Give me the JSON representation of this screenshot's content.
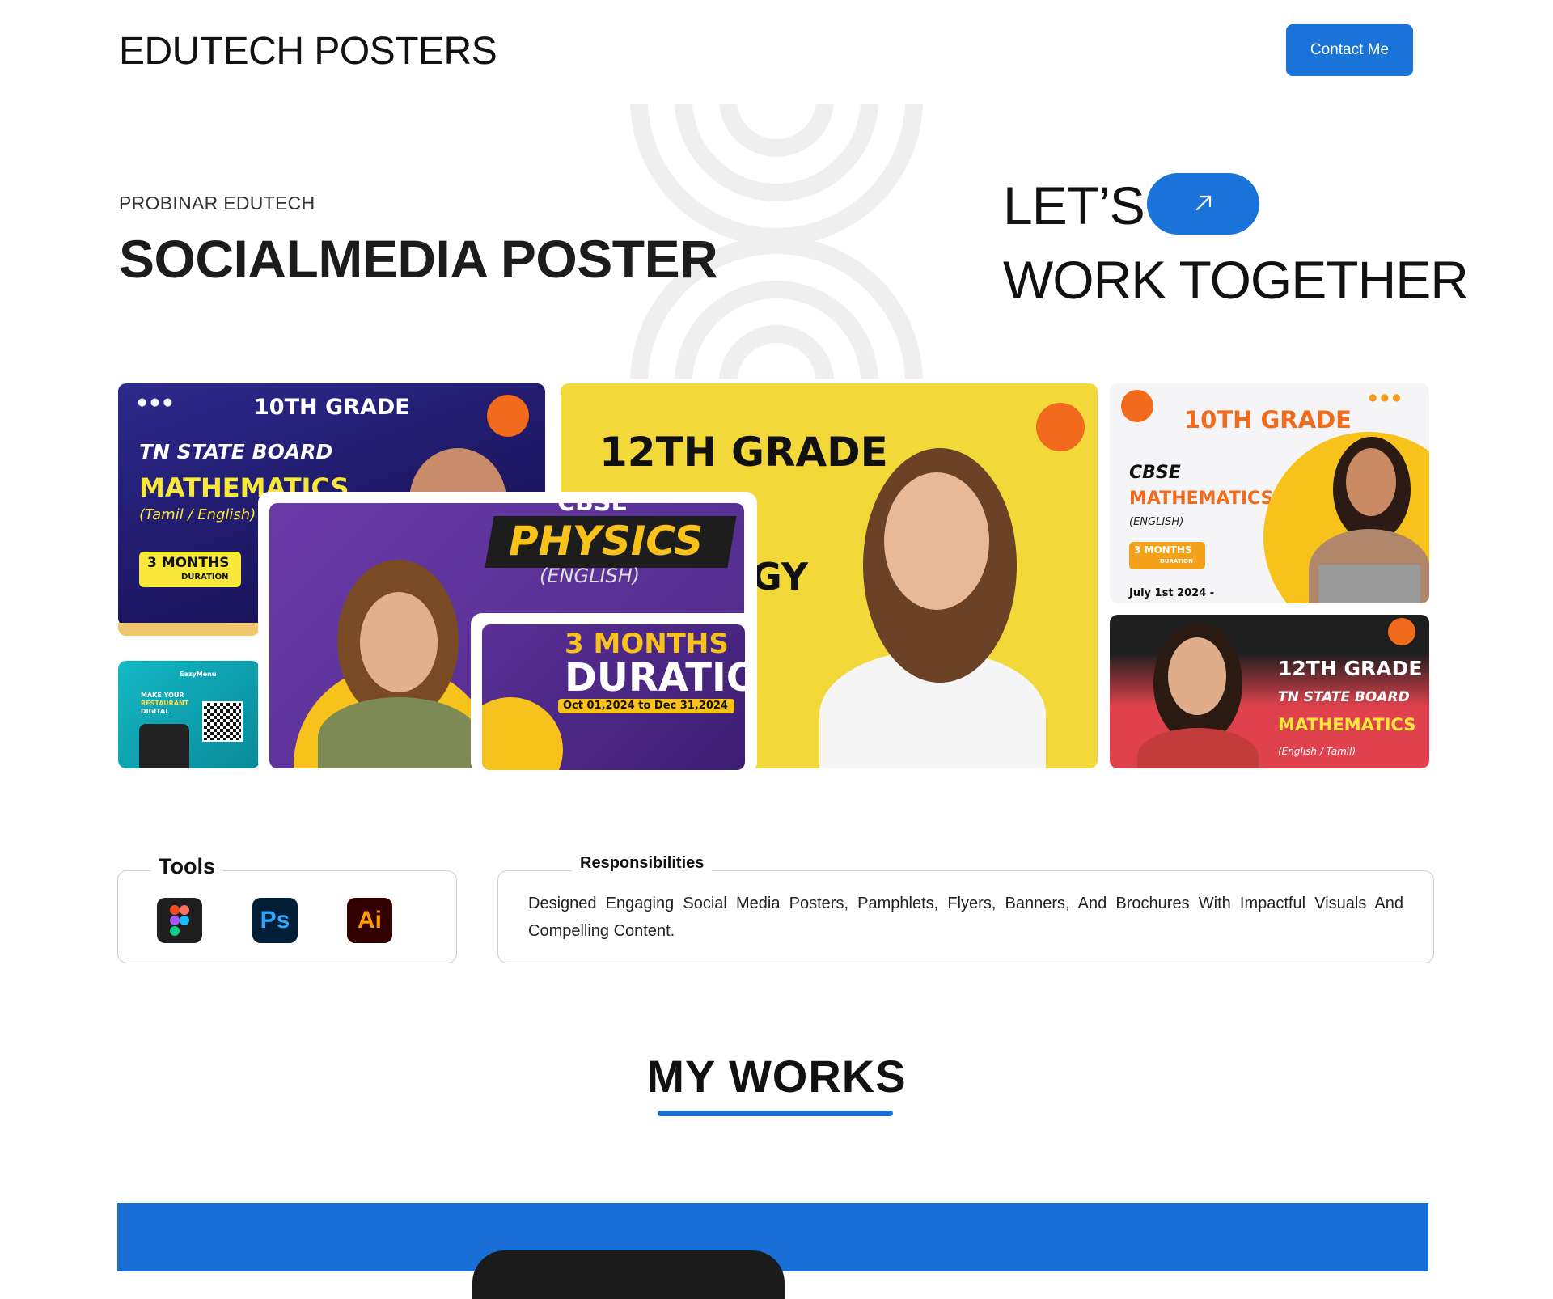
{
  "header": {
    "brand": "EDUTECH POSTERS",
    "contact_label": "Contact Me"
  },
  "hero": {
    "eyebrow": "PROBINAR EDUTECH",
    "title": "SOCIALMEDIA POSTER",
    "cta_line1": "LET’S",
    "cta_line2": "WORK TOGETHER",
    "cta_icon": "arrow-up-right-icon"
  },
  "posters": {
    "p1": {
      "grade": "10TH GRADE",
      "board": "TN STATE BOARD",
      "subject": "MATHEMATICS",
      "lang": "(Tamil / English)",
      "badge1": "3 MONTHS",
      "badge2": "DURATION"
    },
    "p2": {
      "grade": "12TH GRADE",
      "partial": "GY"
    },
    "p3": {
      "grade": "10TH GRADE",
      "board": "CBSE",
      "subject": "MATHEMATICS",
      "lang": "(ENGLISH)",
      "badge1": "3 MONTHS",
      "badge2": "DURATION",
      "date": "July 1st 2024 -"
    },
    "p4": {
      "grade": "12TH GRADE",
      "board": "TN STATE BOARD",
      "subject": "MATHEMATICS",
      "lang": "(English / Tamil)"
    },
    "p5": {
      "top": "CBSE",
      "subject": "PHYSICS",
      "lang": "(ENGLISH)"
    },
    "p6": {
      "line1": "3 MONTHS",
      "line2": "DURATION",
      "dates": "Oct 01,2024 to Dec 31,2024"
    },
    "p7": {
      "brand": "EazyMenu",
      "line1": "MAKE YOUR",
      "line2": "RESTAURANT",
      "line3": "DIGITAL"
    }
  },
  "tools": {
    "label": "Tools",
    "items": [
      {
        "name": "figma-icon",
        "glyph": ""
      },
      {
        "name": "photoshop-icon",
        "glyph": "Ps"
      },
      {
        "name": "illustrator-icon",
        "glyph": "Ai"
      }
    ]
  },
  "responsibilities": {
    "label": "Responsibilities",
    "text": "Designed Engaging Social Media Posters, Pamphlets, Flyers, Banners, And Brochures With Impactful Visuals And Compelling Content."
  },
  "works": {
    "title": "MY WORKS"
  },
  "colors": {
    "accent": "#1a73d9",
    "poster_yellow": "#f3d83a",
    "poster_purple": "#5a2f96",
    "poster_navy": "#2a1f7a",
    "poster_red": "#e0424d",
    "poster_orange": "#f47b20"
  }
}
